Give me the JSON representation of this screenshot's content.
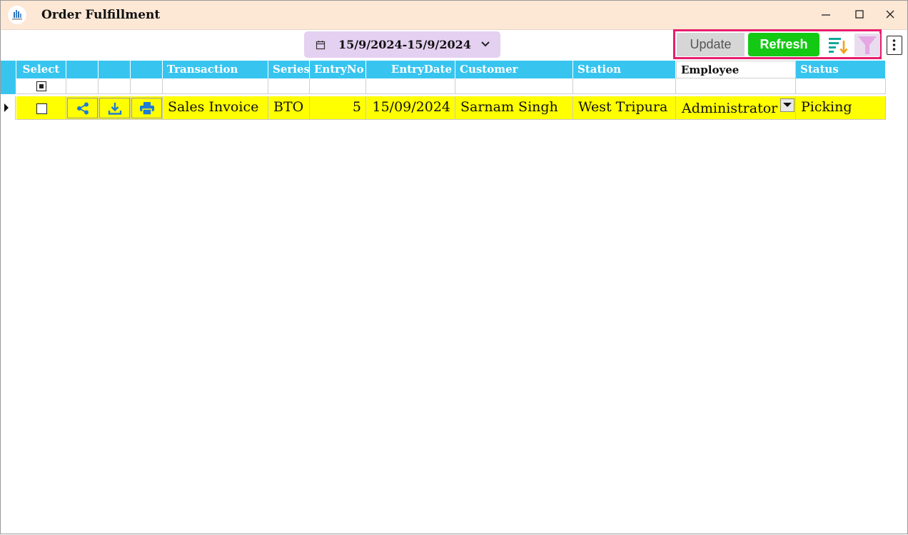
{
  "window": {
    "title": "Order Fulfillment"
  },
  "toolbar": {
    "date_range": "15/9/2024-15/9/2024",
    "update_label": "Update",
    "refresh_label": "Refresh"
  },
  "grid": {
    "columns": [
      "Select",
      "",
      "",
      "",
      "Transaction",
      "Series",
      "EntryNo",
      "EntryDate",
      "Customer",
      "Station",
      "Employee",
      "Status"
    ],
    "rows": [
      {
        "transaction": "Sales Invoice",
        "series": "BTO",
        "entry_no": "5",
        "entry_date": "15/09/2024",
        "customer": "Sarnam Singh",
        "station": "West Tripura",
        "employee": "Administrator",
        "status": "Picking"
      }
    ]
  },
  "colors": {
    "titlebar_bg": "#fde7d5",
    "header_bg": "#37c5f0",
    "row_highlight": "#ffff00",
    "refresh_green": "#13c913",
    "highlight_border": "#e61e6e",
    "date_pill_bg": "#e4d0f1",
    "action_icon_blue": "#1e7bd6"
  },
  "icons": {
    "app": "app-logo-icon",
    "calendar": "calendar-icon",
    "dropdown": "chevron-down-icon",
    "sort": "sort-descending-icon",
    "filter": "filter-funnel-icon",
    "more": "more-vertical-icon",
    "share": "share-icon",
    "download": "download-icon",
    "print": "printer-icon"
  }
}
